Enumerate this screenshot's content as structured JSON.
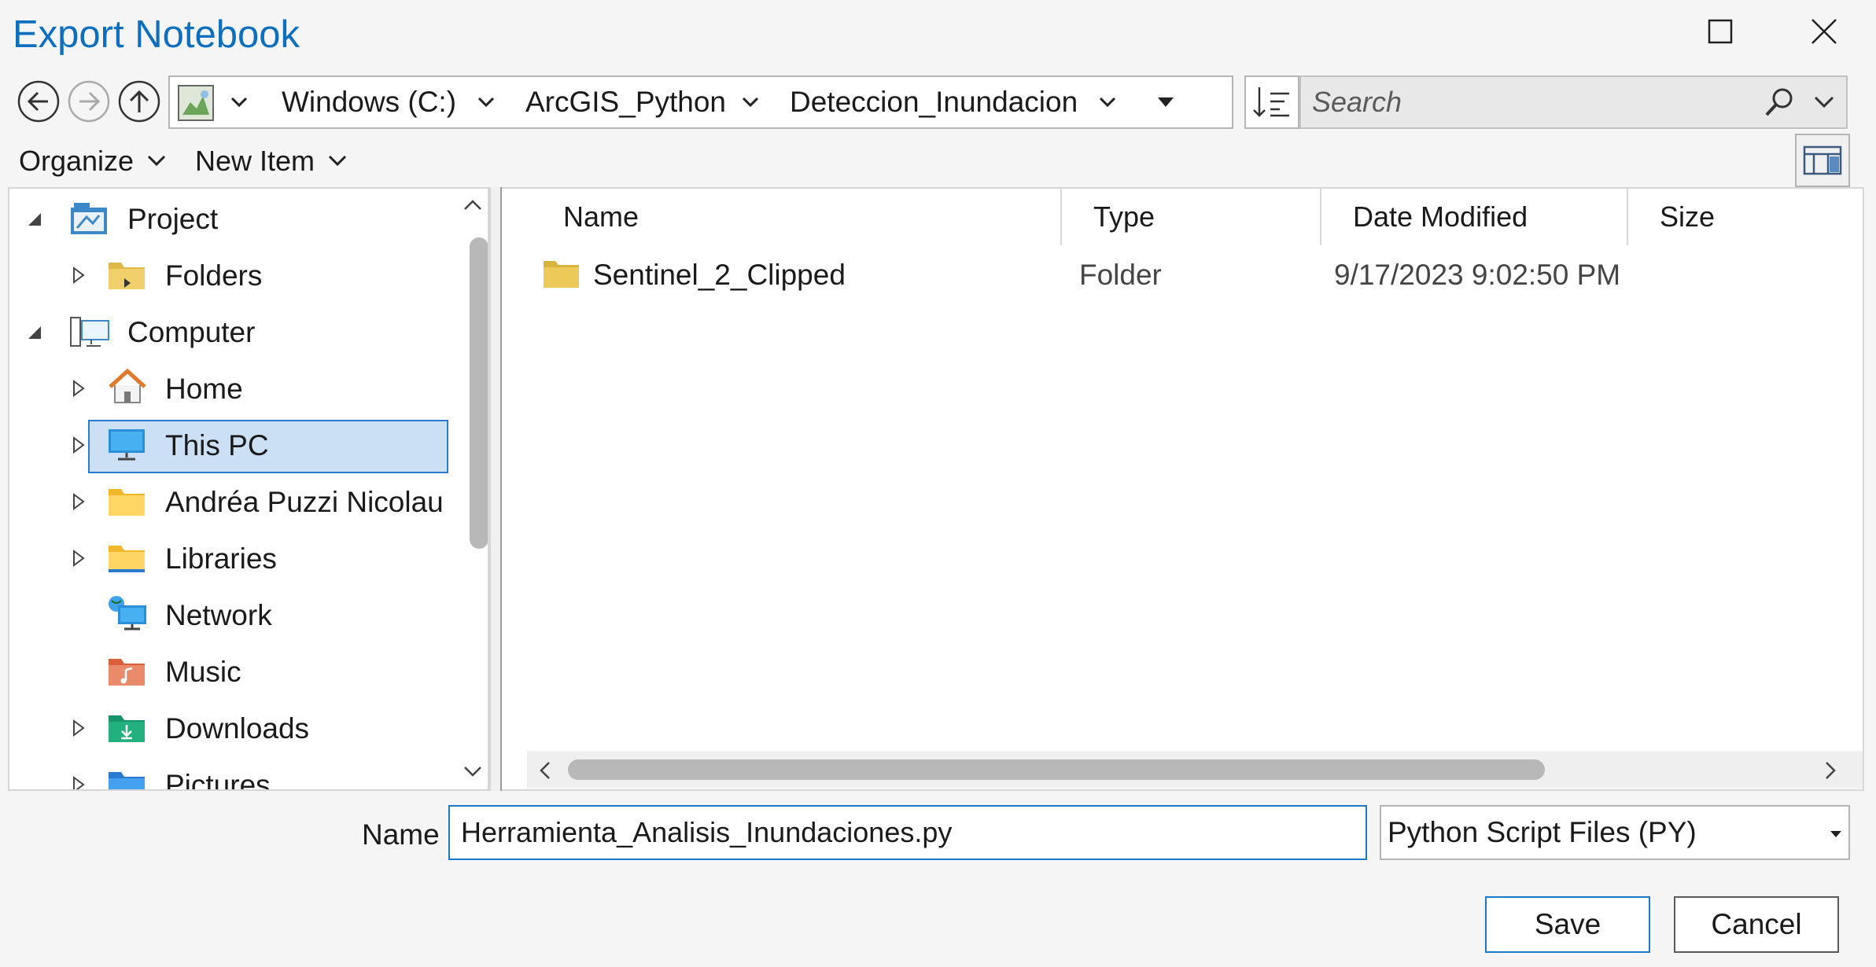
{
  "window": {
    "title": "Export Notebook"
  },
  "breadcrumb": {
    "items": [
      "Windows (C:)",
      "ArcGIS_Python",
      "Deteccion_Inundacion"
    ]
  },
  "search": {
    "placeholder": "Search"
  },
  "toolbar": {
    "organize_label": "Organize",
    "new_item_label": "New Item"
  },
  "tree": {
    "items": [
      {
        "label": "Project",
        "icon": "project-icon",
        "expanded": true
      },
      {
        "label": "Folders",
        "icon": "folders-icon"
      },
      {
        "label": "Computer",
        "icon": "computer-icon",
        "expanded": true
      },
      {
        "label": "Home",
        "icon": "home-icon"
      },
      {
        "label": "This PC",
        "icon": "monitor-icon",
        "selected": true
      },
      {
        "label": "Andréa Puzzi Nicolau",
        "icon": "user-folder-icon"
      },
      {
        "label": "Libraries",
        "icon": "libraries-icon"
      },
      {
        "label": "Network",
        "icon": "network-icon"
      },
      {
        "label": "Music",
        "icon": "music-icon"
      },
      {
        "label": "Downloads",
        "icon": "downloads-icon"
      },
      {
        "label": "Pictures",
        "icon": "pictures-icon"
      }
    ]
  },
  "file_list": {
    "columns": [
      "Name",
      "Type",
      "Date Modified",
      "Size"
    ],
    "rows": [
      {
        "name": "Sentinel_2_Clipped",
        "type": "Folder",
        "date_modified": "9/17/2023 9:02:50 PM",
        "size": ""
      }
    ]
  },
  "footer": {
    "name_label": "Name",
    "name_value": "Herramienta_Analisis_Inundaciones.py",
    "file_type": "Python Script Files (PY)",
    "save_label": "Save",
    "cancel_label": "Cancel"
  },
  "colors": {
    "accent": "#1d78c8",
    "title": "#0f6fbf",
    "selection": "#cce0f5",
    "folder": "#e8c24a"
  }
}
